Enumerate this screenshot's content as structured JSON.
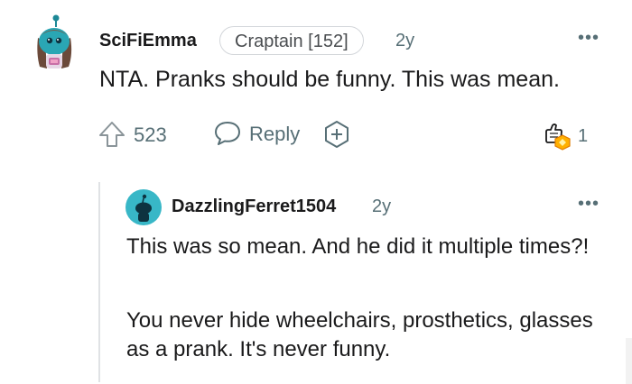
{
  "comment": {
    "username": "SciFiEmma",
    "flair": "Craptain [152]",
    "age": "2y",
    "more": "•••",
    "body": "NTA. Pranks should be funny. This was mean.",
    "votes": "523",
    "reply_label": "Reply",
    "award_count": "1",
    "icons": {
      "avatar": "snoo-avatar-icon",
      "upvote": "upvote-arrow-icon",
      "reply": "speech-bubble-icon",
      "award": "add-award-icon",
      "award_badge": "award-badge-icon"
    }
  },
  "reply": {
    "username": "DazzlingFerret1504",
    "age": "2y",
    "more": "•••",
    "paragraphs": [
      "This was so mean. And he did it multiple times?!",
      "You never hide wheelchairs, prosthetics, glasses as a prank. It's never funny."
    ],
    "icons": {
      "avatar": "default-snoo-avatar-icon"
    }
  },
  "colors": {
    "text": "#1a1a1b",
    "muted": "#576f76",
    "avatar_teal": "#38b7c7",
    "thread_line": "#e0e2e5"
  }
}
